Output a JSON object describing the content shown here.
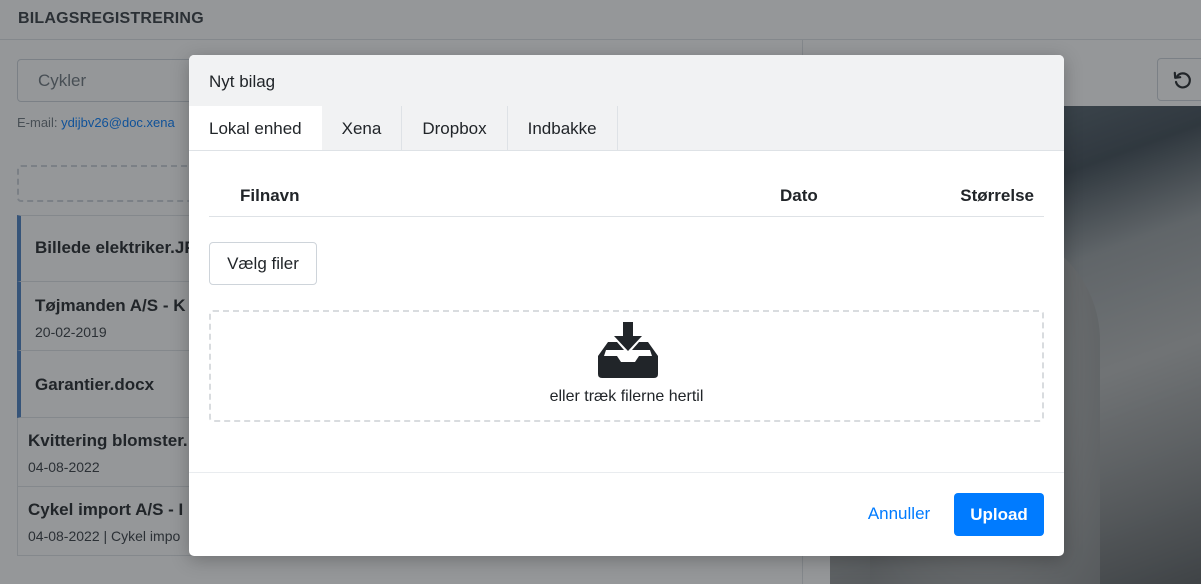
{
  "app": {
    "title": "BILAGSREGISTRERING",
    "search_value": "Cykler",
    "email_label": "E-mail:",
    "email_value": "ydijbv26@doc.xena"
  },
  "documents": [
    {
      "name": "Billede elektriker.JP",
      "sub": ""
    },
    {
      "name": "Tøjmanden A/S - K",
      "sub": "20-02-2019"
    },
    {
      "name": "Garantier.docx",
      "sub": ""
    },
    {
      "name": "Kvittering blomster.",
      "sub": "04-08-2022"
    },
    {
      "name": "Cykel import A/S - I",
      "sub": "04-08-2022 | Cykel impo"
    }
  ],
  "icons": {
    "refresh": "refresh-icon",
    "upload_tray": "inbox-download-icon"
  },
  "modal": {
    "title": "Nyt bilag",
    "tabs": [
      "Lokal enhed",
      "Xena",
      "Dropbox",
      "Indbakke"
    ],
    "active_tab": "Lokal enhed",
    "table_headers": {
      "name": "Filnavn",
      "date": "Dato",
      "size": "Størrelse"
    },
    "choose_files_label": "Vælg filer",
    "drop_text": "eller træk filerne hertil",
    "cancel_label": "Annuller",
    "upload_label": "Upload"
  },
  "colors": {
    "accent": "#007bff",
    "list_marker": "#4a7fc1",
    "overlay": "rgba(33,37,41,0.48)"
  }
}
